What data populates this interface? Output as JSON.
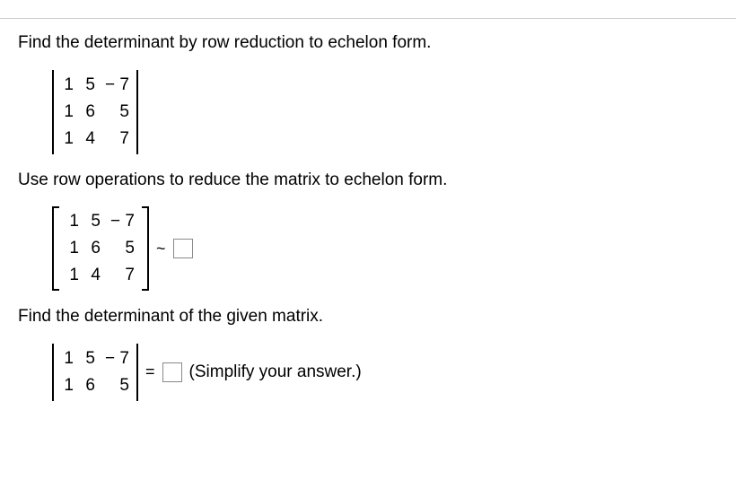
{
  "instruction1": "Find the determinant by row reduction to echelon form.",
  "instruction2": "Use row operations to reduce the matrix to echelon form.",
  "instruction3": "Find the determinant of the given matrix.",
  "matrix1": {
    "r1": {
      "c1": "1",
      "c2": "5",
      "c3": "− 7"
    },
    "r2": {
      "c1": "1",
      "c2": "6",
      "c3": "5"
    },
    "r3": {
      "c1": "1",
      "c2": "4",
      "c3": "7"
    }
  },
  "matrix2": {
    "r1": {
      "c1": "1",
      "c2": "5",
      "c3": "− 7"
    },
    "r2": {
      "c1": "1",
      "c2": "6",
      "c3": "5"
    },
    "r3": {
      "c1": "1",
      "c2": "4",
      "c3": "7"
    }
  },
  "matrix3": {
    "r1": {
      "c1": "1",
      "c2": "5",
      "c3": "− 7"
    },
    "r2": {
      "c1": "1",
      "c2": "6",
      "c3": "5"
    }
  },
  "tilde": "~",
  "equals": "=",
  "simplify_hint": "(Simplify your answer.)"
}
